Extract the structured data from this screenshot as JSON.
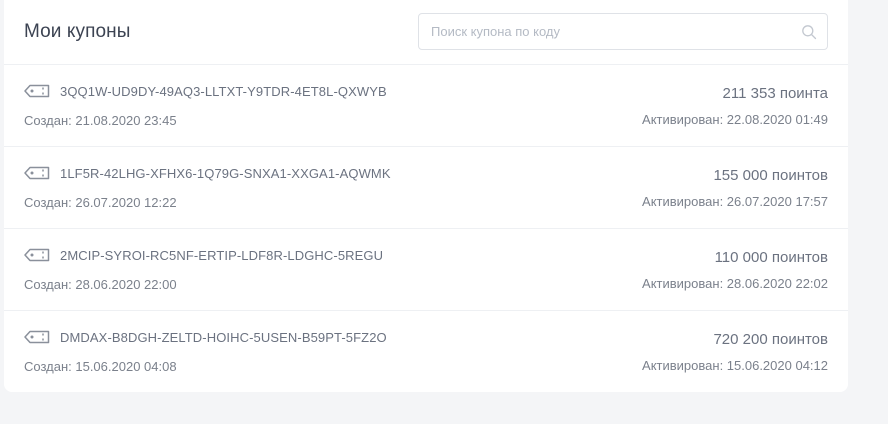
{
  "header": {
    "title": "Мои купоны",
    "search_placeholder": "Поиск купона по коду",
    "search_value": ""
  },
  "icons": {
    "search": "search-icon",
    "coupon": "tag-icon"
  },
  "colors": {
    "background": "#f4f5f7",
    "card": "#ffffff",
    "text_primary": "#3c4352",
    "text_secondary": "#6b7280"
  },
  "coupons": [
    {
      "code": "3QQ1W-UD9DY-49AQ3-LLTXT-Y9TDR-4ET8L-QXWYB",
      "created": "Создан: 21.08.2020 23:45",
      "points": "211 353 поинта",
      "activated": "Активирован: 22.08.2020 01:49"
    },
    {
      "code": "1LF5R-42LHG-XFHX6-1Q79G-SNXA1-XXGA1-AQWMK",
      "created": "Создан: 26.07.2020 12:22",
      "points": "155 000 поинтов",
      "activated": "Активирован: 26.07.2020 17:57"
    },
    {
      "code": "2MCIP-SYROI-RC5NF-ERTIP-LDF8R-LDGHC-5REGU",
      "created": "Создан: 28.06.2020 22:00",
      "points": "110 000 поинтов",
      "activated": "Активирован: 28.06.2020 22:02"
    },
    {
      "code": "DMDAX-B8DGH-ZELTD-HOIHC-5USEN-B59PT-5FZ2O",
      "created": "Создан: 15.06.2020 04:08",
      "points": "720 200 поинтов",
      "activated": "Активирован: 15.06.2020 04:12"
    }
  ]
}
